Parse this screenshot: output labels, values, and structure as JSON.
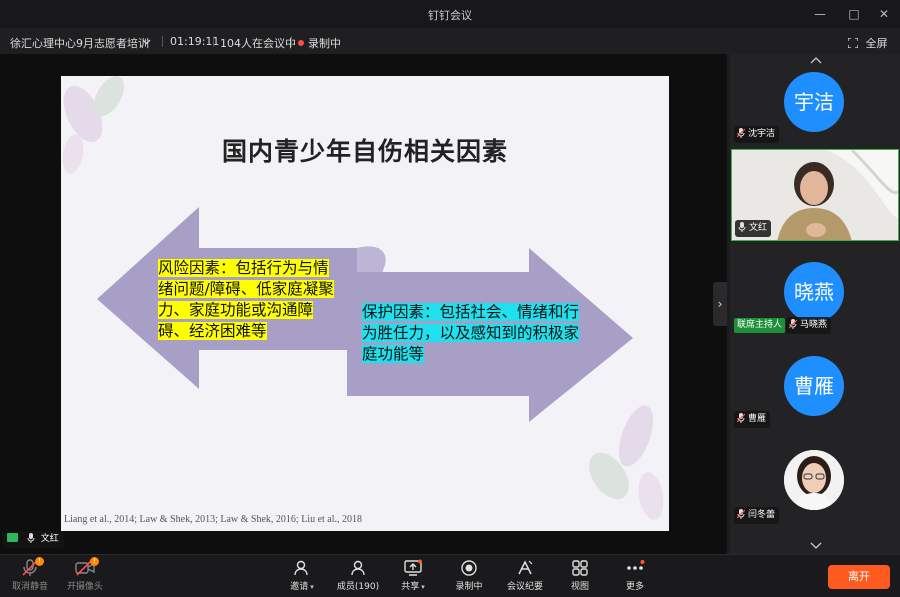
{
  "app": {
    "title": "钉钉会议"
  },
  "meeting": {
    "name": "徐汇心理中心9月志愿者培训",
    "elapsed": "01:19:11",
    "attendees": "104人在会议中",
    "recording": "录制中",
    "fullscreen_label": "全屏"
  },
  "slide": {
    "title": "国内青少年自伤相关因素",
    "risk_text": "风险因素：包括行为与情绪问题/障碍、低家庭凝聚力、家庭功能或沟通障碍、经济困难等",
    "protective_text": "保护因素：包括社会、情绪和行为胜任力，以及感知到的积极家庭功能等",
    "citation": "Liang et al., 2014; Law & Shek, 2013; Law & Shek, 2016; Liu et al., 2018"
  },
  "participants": [
    {
      "avatar_text": "宇洁",
      "name": "沈宇洁"
    },
    {
      "avatar_text": "",
      "name": "文红"
    },
    {
      "avatar_text": "晓燕",
      "name": "马晓燕",
      "badge": "联席主持人"
    },
    {
      "avatar_text": "曹雁",
      "name": "曹雁"
    },
    {
      "avatar_text": "",
      "name": "闫冬蕾"
    }
  ],
  "active_speaker": {
    "name": "文红"
  },
  "toolbar": {
    "mute": "取消静音",
    "camera": "开摄像头",
    "invite": "邀请",
    "members": "成员(190)",
    "share": "共享",
    "recording": "录制中",
    "minutes": "会议纪要",
    "view": "视图",
    "more": "更多",
    "leave": "离开"
  },
  "colors": {
    "accent": "#1f8fff",
    "leave": "#ff5a1f",
    "risk_highlight": "#ffff00",
    "protective_highlight": "#20e0ee",
    "arrow": "#a89fc6"
  }
}
